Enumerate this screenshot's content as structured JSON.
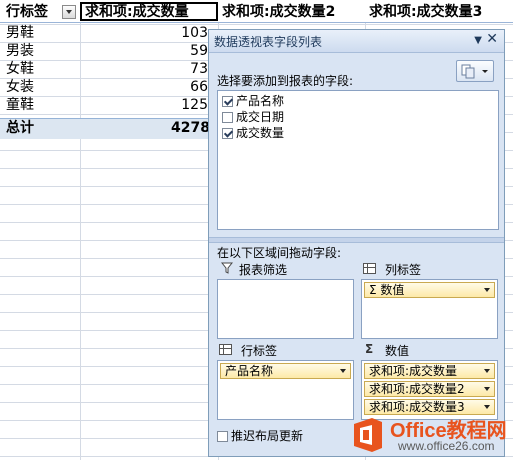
{
  "sheet": {
    "headers": [
      "行标签",
      "求和项:成交数量",
      "求和项:成交数量2",
      "求和项:成交数量3"
    ],
    "rows": [
      {
        "label": "男鞋",
        "value": "103"
      },
      {
        "label": "男装",
        "value": "59"
      },
      {
        "label": "女鞋",
        "value": "73"
      },
      {
        "label": "女装",
        "value": "66"
      },
      {
        "label": "童鞋",
        "value": "125"
      }
    ],
    "total": {
      "label": "总计",
      "value": "4278"
    }
  },
  "panel": {
    "title": "数据透视表字段列表",
    "choose_label": "选择要添加到报表的字段:",
    "fields": [
      {
        "label": "产品名称",
        "checked": true
      },
      {
        "label": "成交日期",
        "checked": false
      },
      {
        "label": "成交数量",
        "checked": true
      }
    ],
    "drag_label": "在以下区域间拖动字段:",
    "report_filter_label": "报表筛选",
    "column_labels_label": "列标签",
    "row_labels_label": "行标签",
    "values_label": "数值",
    "column_items": [
      "Σ 数值"
    ],
    "row_items": [
      "产品名称"
    ],
    "value_items": [
      "求和项:成交数量",
      "求和项:成交数量2",
      "求和项:成交数量3"
    ],
    "defer_label": "推迟布局更新"
  },
  "watermark": {
    "name": "Office教程网",
    "url": "www.office26.com"
  },
  "colors": {
    "accent": "#e8541e",
    "panel_bg": "#d9e4f3",
    "pill": "#fde9a8"
  }
}
